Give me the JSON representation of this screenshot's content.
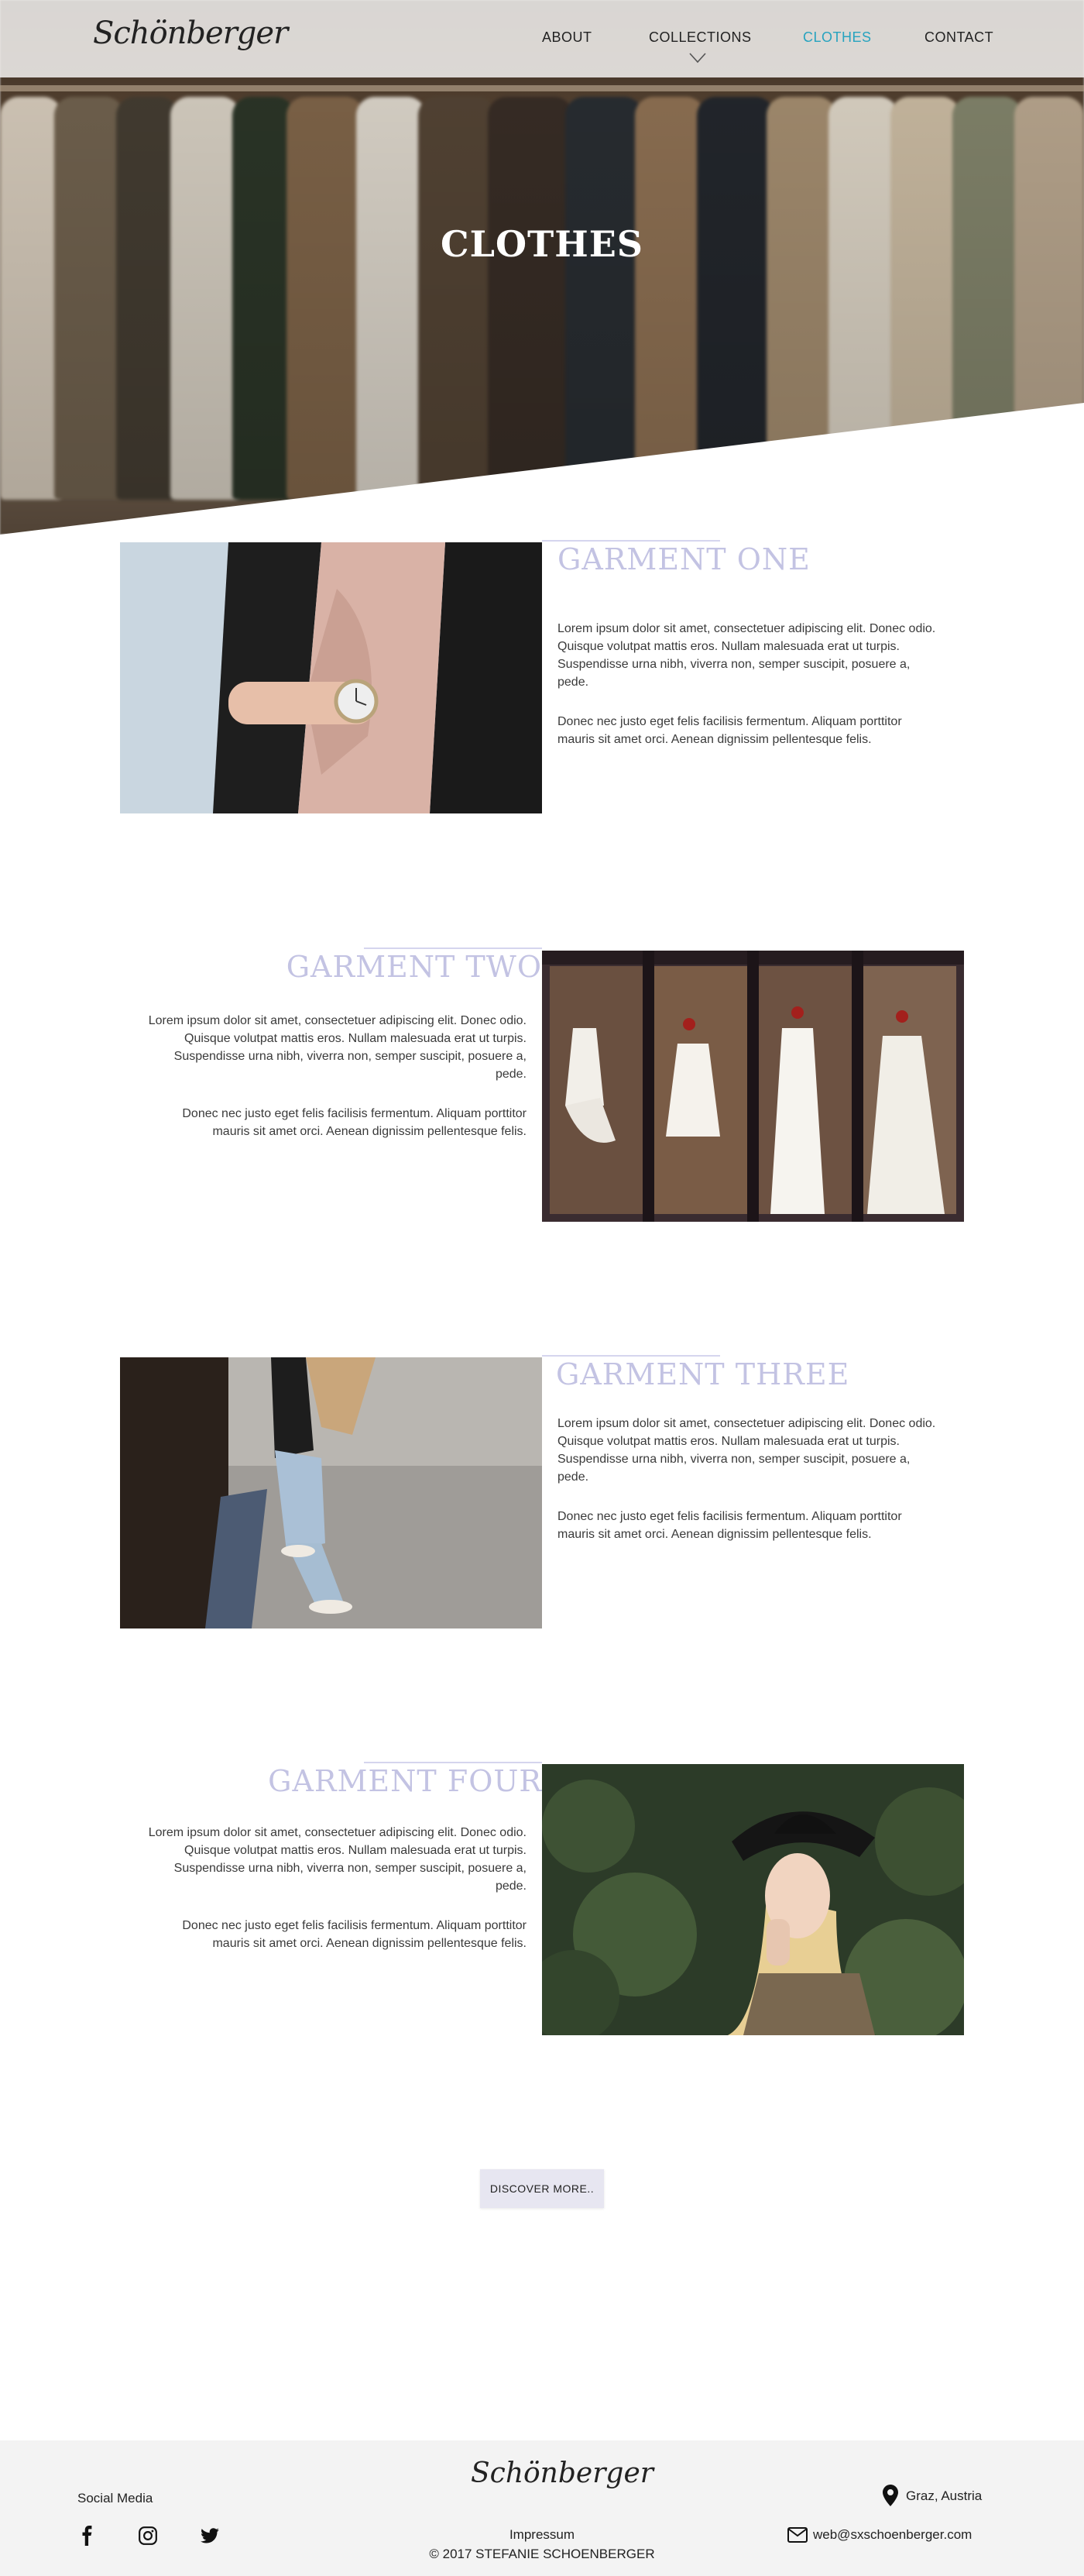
{
  "brand": {
    "logo_text": "Schönberger"
  },
  "nav": {
    "items": [
      {
        "label": "ABOUT"
      },
      {
        "label": "COLLECTIONS"
      },
      {
        "label": "CLOTHES"
      },
      {
        "label": "CONTACT"
      }
    ],
    "active": "CLOTHES",
    "accent_color": "#27a3bf"
  },
  "hero": {
    "title": "CLOTHES"
  },
  "garments": [
    {
      "title": "GARMENT ONE",
      "paragraphs": [
        "Lorem ipsum dolor sit amet, consectetuer adipiscing elit. Donec odio. Quisque volutpat mattis eros. Nullam malesuada erat ut turpis. Suspendisse urna nibh, viverra non, semper suscipit, posuere a, pede.",
        "Donec nec justo eget felis facilisis fermentum. Aliquam porttitor mauris sit amet orci. Aenean dignissim pellentesque felis."
      ]
    },
    {
      "title": "GARMENT TWO",
      "paragraphs": [
        "Lorem ipsum dolor sit amet, consectetuer adipiscing elit. Donec odio. Quisque volutpat mattis eros. Nullam malesuada erat ut turpis. Suspendisse urna nibh, viverra non, semper suscipit, posuere a, pede.",
        "Donec nec justo eget felis facilisis fermentum. Aliquam porttitor mauris sit amet orci. Aenean dignissim pellentesque felis."
      ]
    },
    {
      "title": "GARMENT THREE",
      "paragraphs": [
        "Lorem ipsum dolor sit amet, consectetuer adipiscing elit. Donec odio. Quisque volutpat mattis eros. Nullam malesuada erat ut turpis. Suspendisse urna nibh, viverra non, semper suscipit, posuere a, pede.",
        "Donec nec justo eget felis facilisis fermentum. Aliquam porttitor mauris sit amet orci. Aenean dignissim pellentesque felis."
      ]
    },
    {
      "title": "GARMENT FOUR",
      "paragraphs": [
        "Lorem ipsum dolor sit amet, consectetuer adipiscing elit. Donec odio. Quisque volutpat mattis eros. Nullam malesuada erat ut turpis. Suspendisse urna nibh, viverra non, semper suscipit, posuere a, pede.",
        "Donec nec justo eget felis facilisis fermentum. Aliquam porttitor mauris sit amet orci. Aenean dignissim pellentesque felis."
      ]
    }
  ],
  "title_color": "#c3c3e3",
  "cta": {
    "label": "DISCOVER MORE.."
  },
  "footer": {
    "social_label": "Social Media",
    "social_icons": [
      "facebook-icon",
      "instagram-icon",
      "twitter-icon"
    ],
    "impressum": "Impressum",
    "copyright": "© 2017 STEFANIE SCHOENBERGER",
    "location": "Graz, Austria",
    "email": "web@sxschoenberger.com"
  }
}
